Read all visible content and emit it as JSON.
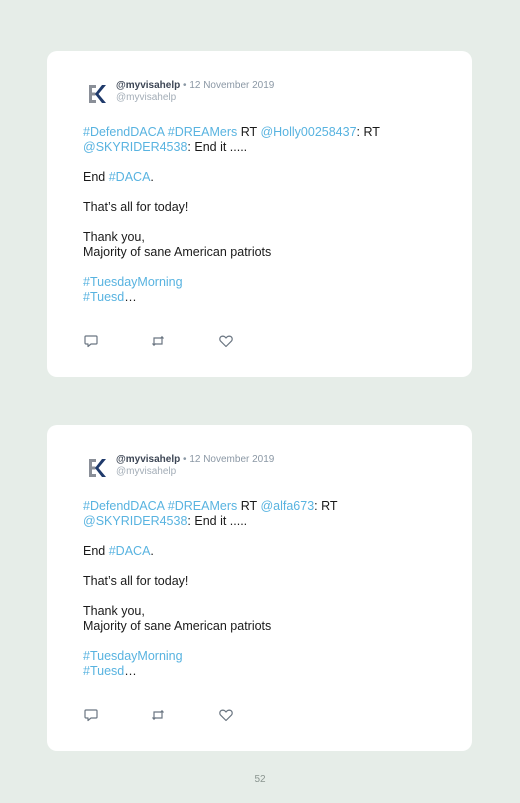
{
  "tweets": [
    {
      "display_name": "@myvisahelp",
      "separator": "•",
      "date": "12 November 2019",
      "handle": "@myvisahelp",
      "line1": {
        "tag1": "#DefendDACA",
        "tag2": "#DREAMers",
        "rt1": "RT",
        "mention1": "@Holly00258437",
        "rt2": ": RT"
      },
      "line2": {
        "mention2": "@SKYRIDER4538",
        "end_text": ": End it ....."
      },
      "end_prefix": "End",
      "end_tag": "#DACA",
      "end_suffix": ".",
      "thats_all": "That’s all for today!",
      "thank_you": "Thank you,",
      "signature": "Majority of sane American patriots",
      "tag_tuesday": "#TuesdayMorning",
      "tag_truncated": "#Tuesd",
      "ellipsis": "…"
    },
    {
      "display_name": "@myvisahelp",
      "separator": "•",
      "date": "12 November 2019",
      "handle": "@myvisahelp",
      "line1": {
        "tag1": "#DefendDACA",
        "tag2": "#DREAMers",
        "rt1": "RT",
        "mention1": "@alfa673",
        "rt2": ": RT"
      },
      "line2": {
        "mention2": "@SKYRIDER4538",
        "end_text": ": End it ....."
      },
      "end_prefix": "End",
      "end_tag": "#DACA",
      "end_suffix": ".",
      "thats_all": "That’s all for today!",
      "thank_you": "Thank you,",
      "signature": "Majority of sane American patriots",
      "tag_tuesday": "#TuesdayMorning",
      "tag_truncated": "#Tuesd",
      "ellipsis": "…"
    }
  ],
  "icons": {
    "logo": "ek-logo-icon",
    "reply": "reply-icon",
    "retweet": "retweet-icon",
    "like": "heart-icon"
  },
  "colors": {
    "background": "#e6ede8",
    "card": "#ffffff",
    "hashtag": "#58b3e0",
    "logo_gray": "#8a8f98",
    "logo_blue": "#1f3a6b"
  },
  "page_number": "52"
}
